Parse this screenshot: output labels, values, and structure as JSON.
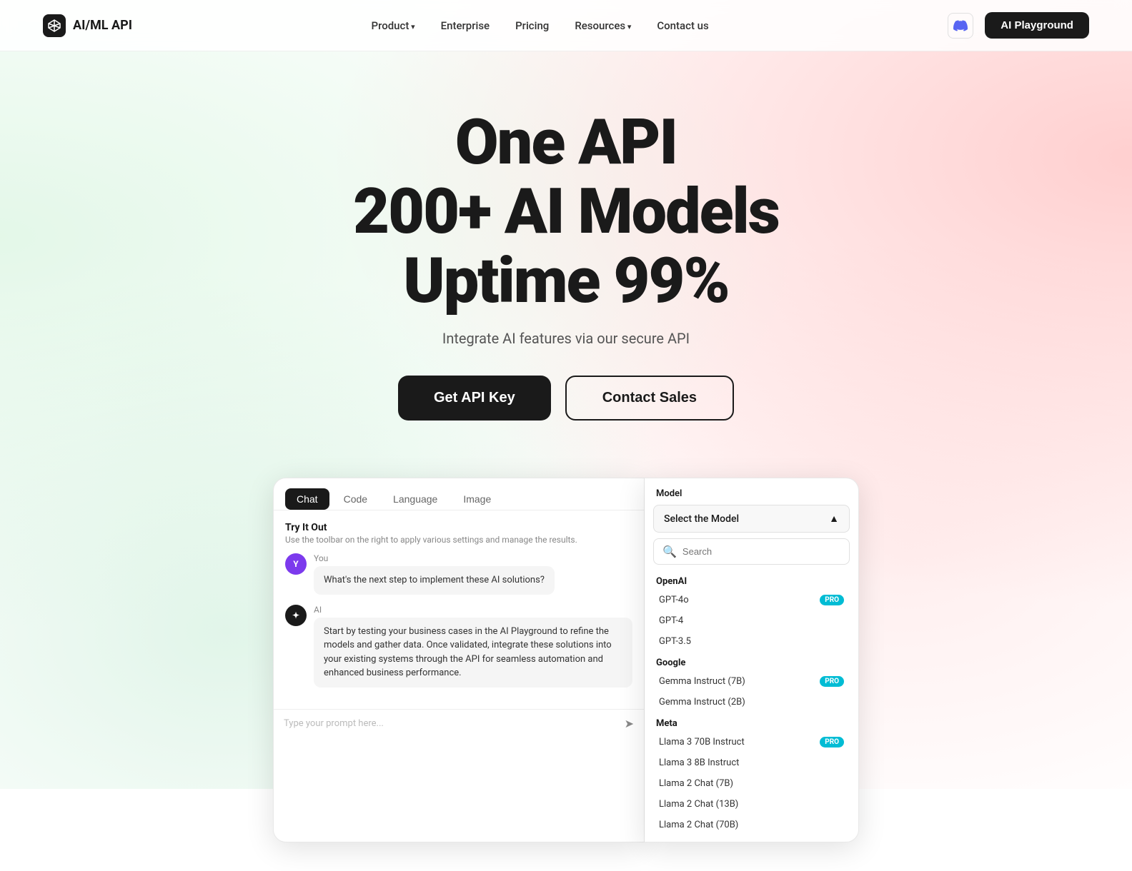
{
  "nav": {
    "logo_text": "AI/ML API",
    "links": [
      {
        "label": "Product",
        "hasArrow": true
      },
      {
        "label": "Enterprise",
        "hasArrow": false
      },
      {
        "label": "Pricing",
        "hasArrow": false
      },
      {
        "label": "Resources",
        "hasArrow": true
      },
      {
        "label": "Contact us",
        "hasArrow": false
      }
    ],
    "playground_button": "AI Playground"
  },
  "hero": {
    "line1": "One API",
    "line2": "200+ AI Models",
    "line3": "Uptime 99%",
    "subtitle": "Integrate AI features via our secure API",
    "btn_primary": "Get API Key",
    "btn_secondary": "Contact Sales"
  },
  "chat_widget": {
    "tabs": [
      "Chat",
      "Code",
      "Language",
      "Image"
    ],
    "active_tab": "Chat",
    "try_it_out_title": "Try It Out",
    "try_it_out_desc": "Use the toolbar on the right to apply various settings and manage the results.",
    "user_label": "You",
    "user_message": "What's the next step to implement these AI solutions?",
    "ai_label": "AI",
    "ai_message": "Start by testing your business cases in the AI Playground to refine the models and gather data. Once validated, integrate these solutions into your existing systems through the API for seamless automation and enhanced business performance.",
    "input_placeholder": "Type your prompt here...",
    "user_avatar_letter": "Y",
    "ai_avatar_letter": "✦"
  },
  "model_panel": {
    "label": "Model",
    "select_placeholder": "Select the Model",
    "search_placeholder": "Search",
    "groups": [
      {
        "name": "OpenAI",
        "models": [
          {
            "name": "GPT-4o",
            "pro": true
          },
          {
            "name": "GPT-4",
            "pro": false
          },
          {
            "name": "GPT-3.5",
            "pro": false
          }
        ]
      },
      {
        "name": "Google",
        "models": [
          {
            "name": "Gemma Instruct (7B)",
            "pro": true
          },
          {
            "name": "Gemma Instruct (2B)",
            "pro": false
          }
        ]
      },
      {
        "name": "Meta",
        "models": [
          {
            "name": "Llama 3 70B Instruct",
            "pro": true
          },
          {
            "name": "Llama 3 8B Instruct",
            "pro": false
          },
          {
            "name": "Llama 2 Chat (7B)",
            "pro": false
          },
          {
            "name": "Llama 2 Chat (13B)",
            "pro": false
          },
          {
            "name": "Llama 2 Chat (70B)",
            "pro": false
          }
        ]
      }
    ],
    "pro_badge": "PRO"
  }
}
